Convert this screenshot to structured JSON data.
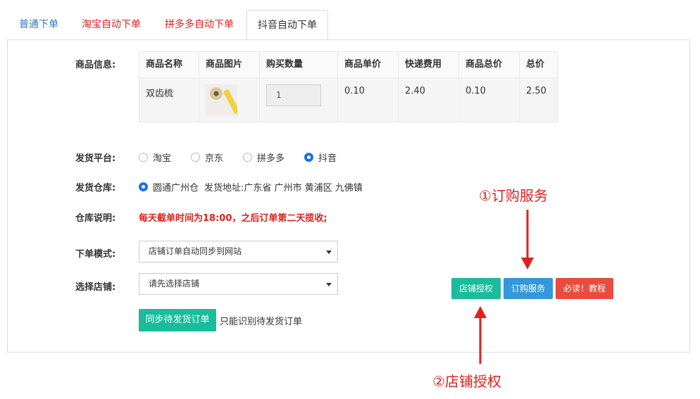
{
  "tabs": [
    {
      "label": "普通下单"
    },
    {
      "label": "淘宝自动下单"
    },
    {
      "label": "拼多多自动下单"
    },
    {
      "label": "抖音自动下单"
    }
  ],
  "product": {
    "section_label": "商品信息:",
    "headers": [
      "商品名称",
      "商品图片",
      "购买数量",
      "商品单价",
      "快递费用",
      "商品总价",
      "总价"
    ],
    "row": {
      "name": "双齿梳",
      "quantity": "1",
      "unit_price": "0.10",
      "shipping": "2.40",
      "subtotal": "0.10",
      "total": "2.50"
    }
  },
  "platform": {
    "label": "发货平台:",
    "options": [
      "淘宝",
      "京东",
      "拼多多",
      "抖音"
    ],
    "selected": "抖音"
  },
  "warehouse": {
    "label": "发货仓库:",
    "name": "圆通广州仓",
    "address": "发货地址:广东省 广州市 黄浦区 九佛镇"
  },
  "warehouse_note": {
    "label": "仓库说明:",
    "text": "每天截单时间为18:00，之后订单第二天揽收;"
  },
  "order_mode": {
    "label": "下单模式:",
    "value": "店铺订单自动同步到网站"
  },
  "shop": {
    "label": "选择店铺:",
    "value": "请先选择店铺"
  },
  "actions": {
    "sync_label": "同步待发货订单",
    "sync_hint": "只能识别待发货订单",
    "auth_label": "店铺授权",
    "subscribe_label": "订购服务",
    "tutorial_label": "必读！教程"
  },
  "annotations": {
    "one": "①订购服务",
    "two": "②店铺授权",
    "color": "#e0201c"
  },
  "colors": {
    "green": "#1abc9c",
    "blue": "#3498db",
    "red": "#e74c3c",
    "link": "#337ab7"
  }
}
